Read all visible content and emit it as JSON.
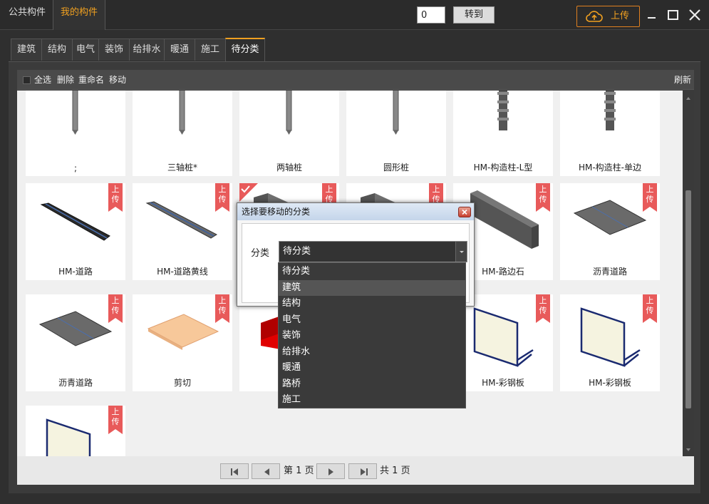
{
  "top_tabs": {
    "public": "公共构件",
    "mine": "我的构件"
  },
  "upload_label": "上传",
  "category_tabs": [
    "建筑",
    "结构",
    "电气",
    "装饰",
    "给排水",
    "暖通",
    "施工",
    "待分类"
  ],
  "active_tab": "待分类",
  "toolbar": {
    "select_all": "全选",
    "delete": "删除",
    "rename": "重命名",
    "move": "移动",
    "refresh": "刷新"
  },
  "ribbon_text": [
    "上",
    "传"
  ],
  "components": [
    {
      "label": ";",
      "thumb": "pile-icon",
      "uploaded": false
    },
    {
      "label": "三轴桩*",
      "thumb": "pile-icon",
      "uploaded": false
    },
    {
      "label": "两轴桩",
      "thumb": "pile-icon",
      "uploaded": false
    },
    {
      "label": "圆形桩",
      "thumb": "pile-icon",
      "uploaded": false
    },
    {
      "label": "HM-构造柱-L型",
      "thumb": "column-icon",
      "uploaded": false
    },
    {
      "label": "HM-构造柱-单边",
      "thumb": "column-icon",
      "uploaded": false
    },
    {
      "label": "HM-道路",
      "thumb": "road-strip-icon",
      "uploaded": true
    },
    {
      "label": "HM-道路黄线",
      "thumb": "road-line-icon",
      "uploaded": true
    },
    {
      "label": "",
      "thumb": "beam-icon",
      "uploaded": true,
      "checked": true
    },
    {
      "label": "",
      "thumb": "beam-icon",
      "uploaded": true
    },
    {
      "label": "HM-路边石",
      "thumb": "curb-icon",
      "uploaded": true
    },
    {
      "label": "沥青道路",
      "thumb": "asphalt-icon",
      "uploaded": true
    },
    {
      "label": "沥青道路",
      "thumb": "asphalt-icon",
      "uploaded": true
    },
    {
      "label": "剪切",
      "thumb": "shear-plate-icon",
      "uploaded": true
    },
    {
      "label": "HM-",
      "thumb": "red-block-icon",
      "uploaded": true
    },
    {
      "label": "",
      "thumb": "blank",
      "uploaded": true
    },
    {
      "label": "HM-彩钢板",
      "thumb": "steel-panel-icon",
      "uploaded": true
    },
    {
      "label": "HM-彩钢板",
      "thumb": "steel-panel-icon",
      "uploaded": true
    },
    {
      "label": "",
      "thumb": "steel-panel-icon",
      "uploaded": true
    }
  ],
  "pager": {
    "page_prefix": "第",
    "page_num": "1",
    "page_suffix": "页",
    "total_prefix": "共",
    "total_num": "1",
    "total_suffix": "页",
    "input_value": "0",
    "goto": "转到"
  },
  "dialog": {
    "title": "选择要移动的分类",
    "label": "分类",
    "selected": "待分类",
    "options": [
      "待分类",
      "建筑",
      "结构",
      "电气",
      "装饰",
      "给排水",
      "暖通",
      "路桥",
      "施工"
    ],
    "hovered": "建筑"
  },
  "colors": {
    "accent": "#f0a020",
    "ribbon": "#e85a5a"
  }
}
